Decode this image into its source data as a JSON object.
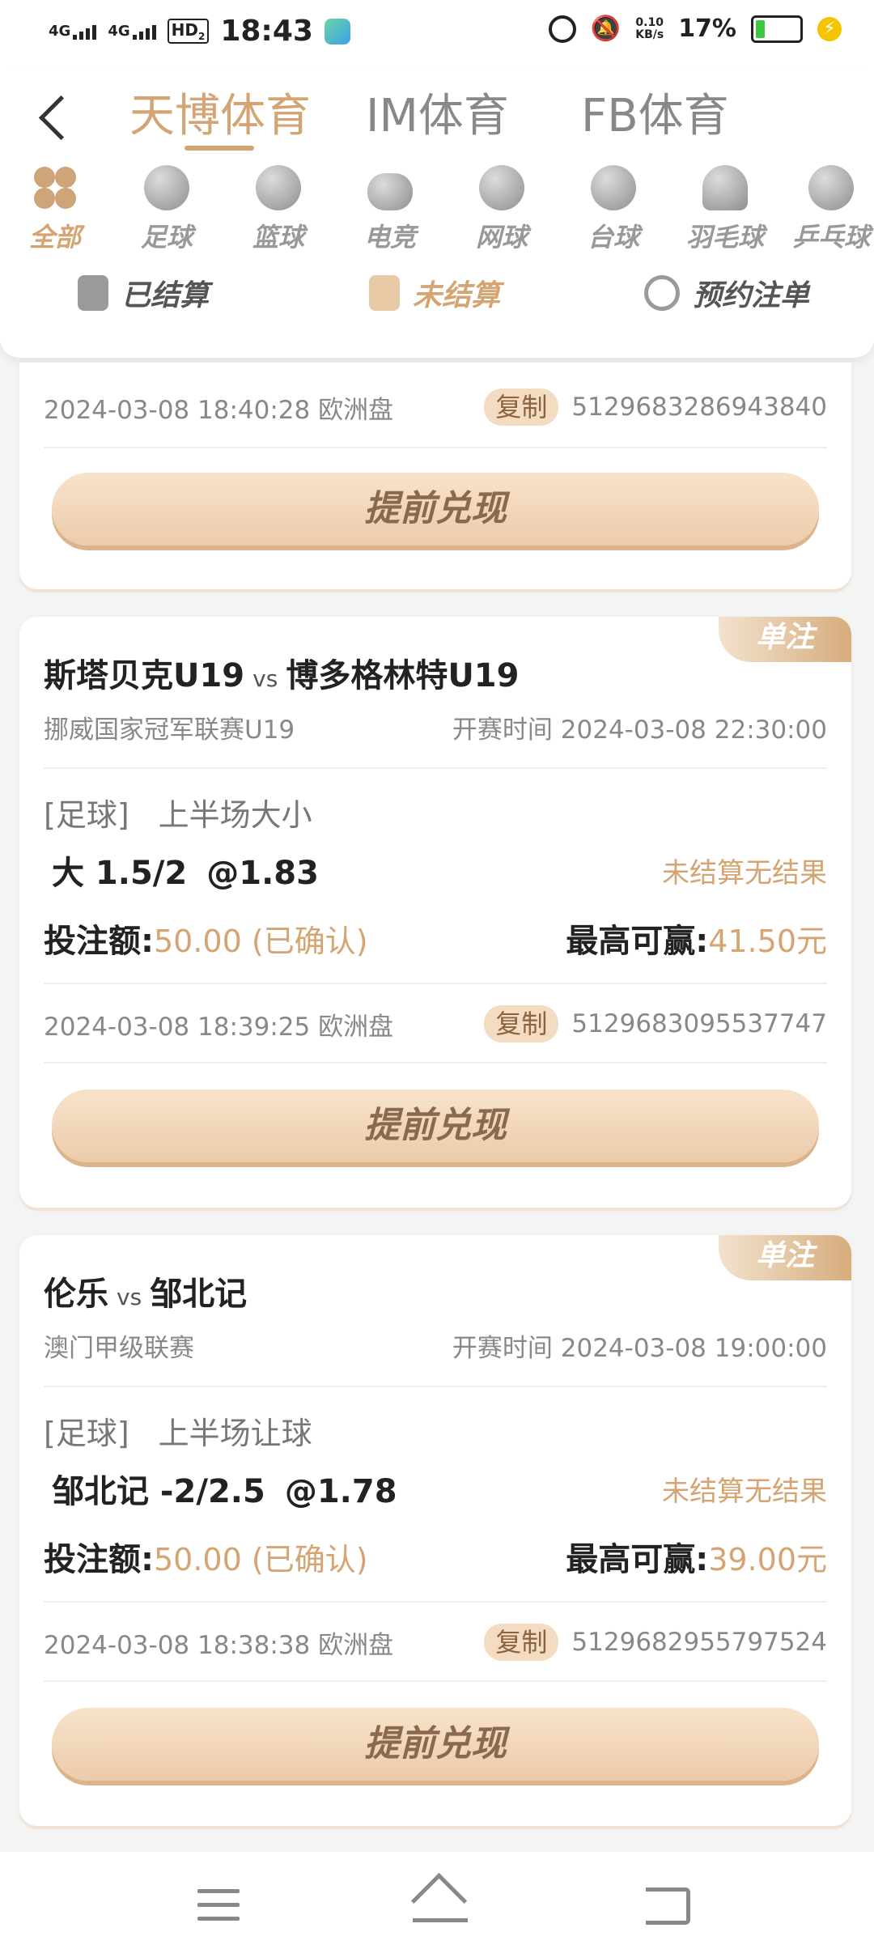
{
  "status_bar": {
    "network1": "4G",
    "network2": "4G",
    "hd": "HD",
    "hd_sub": "2",
    "time": "18:43",
    "speed_value": "0.10",
    "speed_unit": "KB/s",
    "battery": "17%"
  },
  "header": {
    "tabs": [
      {
        "label": "天博体育",
        "active": true
      },
      {
        "label": "IM体育",
        "active": false
      },
      {
        "label": "FB体育",
        "active": false
      }
    ],
    "categories": [
      {
        "label": "全部",
        "icon": "clover-icon",
        "active": true
      },
      {
        "label": "足球",
        "icon": "soccer-ball-icon"
      },
      {
        "label": "篮球",
        "icon": "basketball-icon"
      },
      {
        "label": "电竞",
        "icon": "gamepad-icon"
      },
      {
        "label": "网球",
        "icon": "tennis-ball-icon"
      },
      {
        "label": "台球",
        "icon": "billiard-ball-icon"
      },
      {
        "label": "羽毛球",
        "icon": "shuttlecock-icon"
      },
      {
        "label": "乒乓球",
        "icon": "ping-pong-icon"
      }
    ],
    "subtabs": [
      {
        "label": "已结算",
        "active": false
      },
      {
        "label": "未结算",
        "active": true
      },
      {
        "label": "预约注单",
        "active": false
      }
    ]
  },
  "cards": [
    {
      "datetime": "2024-03-08 18:40:28 欧洲盘",
      "copy": "复制",
      "order_no": "5129683286943840",
      "cashout": "提前兑现"
    },
    {
      "tag": "单注",
      "home": "斯塔贝克U19",
      "vs": "vs",
      "away": "博多格林特U19",
      "league": "挪威国家冠军联赛U19",
      "start_label": "开赛时间",
      "start_time": "2024-03-08 22:30:00",
      "sport": "[足球]",
      "market": "上半场大小",
      "pick": "大 1.5/2",
      "odds": "@1.83",
      "status": "未结算无结果",
      "stake_label": "投注额:",
      "stake_value": "50.00 (已确认)",
      "win_label": "最高可赢:",
      "win_value": "41.50元",
      "datetime": "2024-03-08 18:39:25 欧洲盘",
      "copy": "复制",
      "order_no": "5129683095537747",
      "cashout": "提前兑现"
    },
    {
      "tag": "单注",
      "home": "伦乐",
      "vs": "vs",
      "away": "邹北记",
      "league": "澳门甲级联赛",
      "start_label": "开赛时间",
      "start_time": "2024-03-08 19:00:00",
      "sport": "[足球]",
      "market": "上半场让球",
      "pick": "邹北记 -2/2.5",
      "odds": "@1.78",
      "status": "未结算无结果",
      "stake_label": "投注额:",
      "stake_value": "50.00 (已确认)",
      "win_label": "最高可赢:",
      "win_value": "39.00元",
      "datetime": "2024-03-08 18:38:38 欧洲盘",
      "copy": "复制",
      "order_no": "5129682955797524",
      "cashout": "提前兑现"
    }
  ],
  "colors": {
    "accent": "#d4a572",
    "button_bg": "#eccbaa",
    "text_dark": "#222222"
  }
}
